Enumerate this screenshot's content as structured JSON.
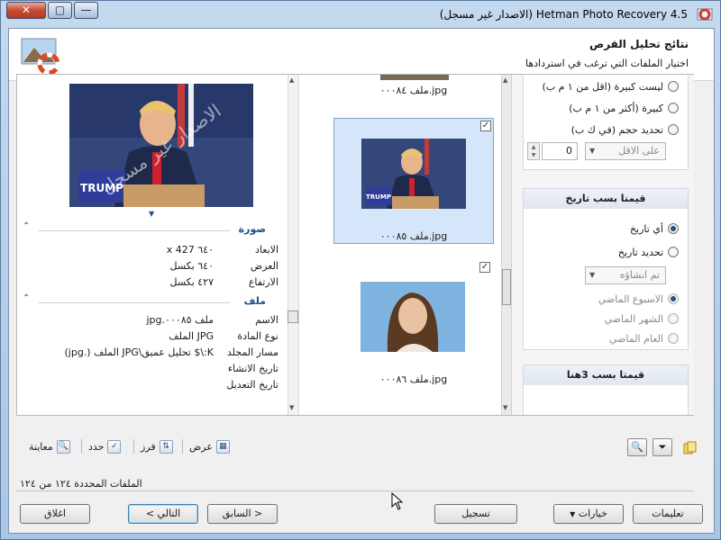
{
  "window": {
    "title": "Hetman Photo Recovery 4.5 (الاصدار غير مسجل)",
    "close_glyph": "✕",
    "max_glyph": "▢",
    "min_glyph": "—"
  },
  "header": {
    "title": "نتائج تحليل القرص",
    "subtitle": "اختيار الملفات التي ترغب في استردادها"
  },
  "preview": {
    "section_image": "صورة",
    "section_file": "ملف",
    "image_props": [
      {
        "key": "الابعاد",
        "value": "٦٤٠ x 427"
      },
      {
        "key": "العرض",
        "value": "٦٤٠ بكسل"
      },
      {
        "key": "الارتفاع",
        "value": "٤٢٧ بكسل"
      }
    ],
    "file_props": [
      {
        "key": "الاسم",
        "value": "ملف ٠٠٠٨٥.jpg"
      },
      {
        "key": "نوع المادة",
        "value": "JPG الملف"
      },
      {
        "key": "مسار المجلد",
        "value": "K:\\$ تحليل عميق\\JPG الملف (.jpg)"
      },
      {
        "key": "تاريخ الانشاء",
        "value": ""
      },
      {
        "key": "تاريخ التعديل",
        "value": ""
      }
    ],
    "watermark": "الاصدار غير مسجل"
  },
  "thumbnails": [
    {
      "label": "ملف ٠٠٠٨٤.jpg",
      "checked": false
    },
    {
      "label": "ملف ٠٠٠٨٥.jpg",
      "checked": true,
      "selected": true
    },
    {
      "label": "ملف ٠٠٠٨٦.jpg",
      "checked": true
    }
  ],
  "filters": {
    "size_options": [
      {
        "label": "ليست كبيرة (اقل من ١ م ب)",
        "on": false
      },
      {
        "label": "كبيرة (أكثر من ١ م ب)",
        "on": false
      },
      {
        "label": "تحديد حجم (في ك ب)",
        "on": false
      }
    ],
    "size_select": "على الاقل",
    "size_value": "0",
    "date_group_title": "قيمتا بسب تاريخ",
    "date_options": [
      {
        "label": "أي تاريخ",
        "on": true,
        "disabled": false
      },
      {
        "label": "تحديد تاريخ",
        "on": false,
        "disabled": false
      }
    ],
    "date_select": "تم انشاؤه",
    "date_sub_options": [
      {
        "label": "الاسبوع الماضي",
        "on": true
      },
      {
        "label": "الشهر الماضي",
        "on": false
      },
      {
        "label": "العام الماضي",
        "on": false
      }
    ],
    "third_group_title": "قيمتا بسب 3هنا"
  },
  "toolbar": {
    "preview_label": "معاينة",
    "select_label": "حدد",
    "sort_label": "فرز",
    "view_label": "عرض"
  },
  "status": "الملفات المحددة ١٢٤ من ١٢٤",
  "buttons": {
    "close": "اغلاق",
    "next": "التالي >",
    "back": "< السابق",
    "register": "تسجيل",
    "options": "خيارات",
    "help": "تعليمات"
  }
}
